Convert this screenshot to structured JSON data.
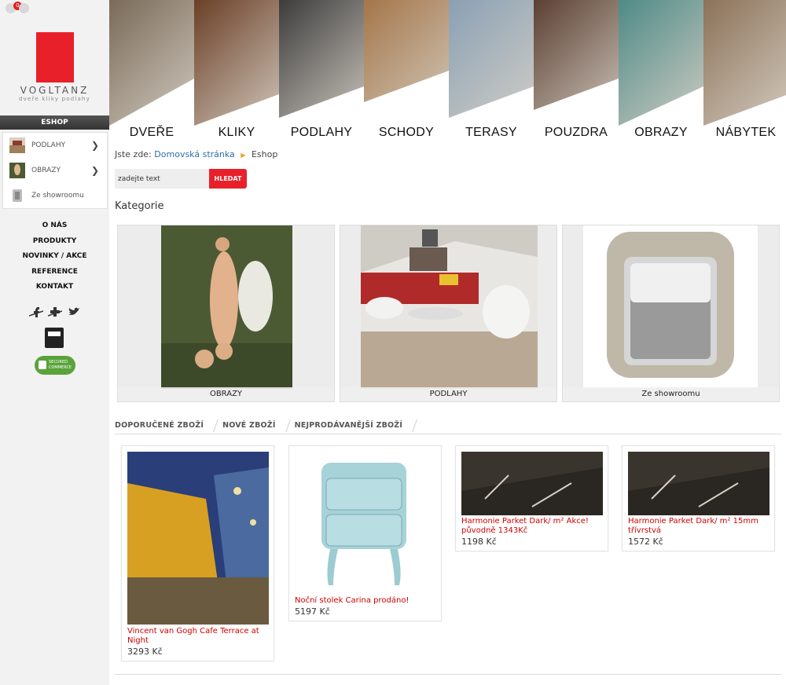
{
  "header": {
    "cart_count": "0",
    "logo_name": "VOGLTANZ",
    "logo_tagline": "dveře kliky podlahy",
    "tiles": [
      {
        "label": "DVEŘE",
        "bg": "#7a6a58"
      },
      {
        "label": "KLIKY",
        "bg": "#6b3f26"
      },
      {
        "label": "PODLAHY",
        "bg": "#3c3c3c"
      },
      {
        "label": "SCHODY",
        "bg": "#a4764a"
      },
      {
        "label": "TERASY",
        "bg": "#8aa0b4"
      },
      {
        "label": "POUZDRA",
        "bg": "#5b4033"
      },
      {
        "label": "OBRAZY",
        "bg": "#4f8a86"
      },
      {
        "label": "NÁBYTEK",
        "bg": "#8c7258"
      }
    ]
  },
  "sidebar": {
    "eshop_label": "ESHOP",
    "categories": [
      {
        "label": "PODLAHY",
        "has_arrow": true
      },
      {
        "label": "OBRAZY",
        "has_arrow": true
      },
      {
        "label": "Ze showroomu",
        "has_arrow": false
      }
    ],
    "nav": [
      "O NÁS",
      "PRODUKTY",
      "NOVINKY / AKCE",
      "REFERENCE",
      "KONTAKT"
    ],
    "social_icons": [
      "facebook-icon",
      "google-plus-icon",
      "twitter-icon"
    ],
    "secured_text": "SECURED COMMERCE"
  },
  "breadcrumb": {
    "prefix": "Jste zde:",
    "home": "Domovská stránka",
    "current": "Eshop"
  },
  "search": {
    "value": "zadejte text",
    "button": "HLEDAT"
  },
  "categories_title": "Kategorie",
  "category_cards": [
    {
      "caption": "OBRAZY"
    },
    {
      "caption": "PODLAHY"
    },
    {
      "caption": "Ze showroomu"
    }
  ],
  "tabs": [
    "DOPORUČENÉ ZBOŽÍ",
    "NOVÉ ZBOŽÍ",
    "NEJPRODÁVANĚJŠÍ ZBOŽÍ"
  ],
  "products": [
    {
      "name": "Vincent van Gogh Cafe Terrace at Night",
      "price": "3293 Kč"
    },
    {
      "name": "Noční stolek Carina prodáno!",
      "price": "5197 Kč"
    },
    {
      "name": "Harmonie Parket Dark/ m² Akce! původně 1343Kč",
      "price": "1198 Kč"
    },
    {
      "name": "Harmonie Parket Dark/ m² 15mm třívrstvá",
      "price": "1572 Kč"
    }
  ]
}
